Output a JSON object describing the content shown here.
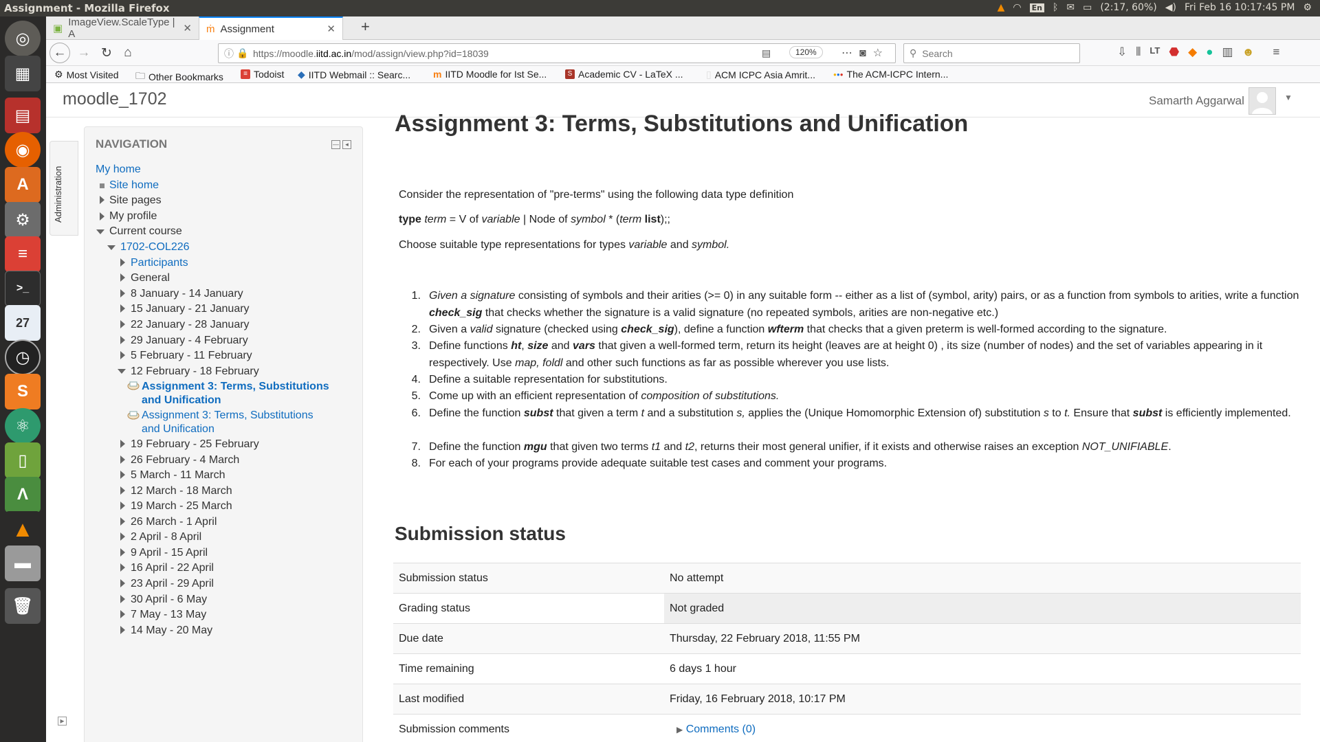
{
  "os": {
    "window_title": "Assignment - Mozilla Firefox",
    "keyboard": "En",
    "battery": "(2:17, 60%)",
    "clock": "Fri Feb 16 10:17:45 PM"
  },
  "browser": {
    "tabs": [
      {
        "label": "ImageView.ScaleType | A"
      },
      {
        "label": "Assignment"
      }
    ],
    "url_prefix": "https://moodle.",
    "url_domain": "iitd.ac.in",
    "url_suffix": "/mod/assign/view.php?id=18039",
    "zoom": "120%",
    "search_placeholder": "Search",
    "bookmarks": [
      {
        "label": "Most Visited"
      },
      {
        "label": "Other Bookmarks"
      },
      {
        "label": "Todoist"
      },
      {
        "label": "IITD Webmail :: Searc..."
      },
      {
        "label": "IITD Moodle for Ist Se..."
      },
      {
        "label": "Academic CV - LaTeX ..."
      },
      {
        "label": "ACM ICPC Asia Amrit..."
      },
      {
        "label": "The ACM-ICPC Intern..."
      }
    ]
  },
  "launcher": {
    "calendar_day": "27"
  },
  "site": {
    "name": "moodle_1702",
    "user": "Samarth Aggarwal"
  },
  "admin_tab": "Administration",
  "navigation": {
    "title": "NAVIGATION",
    "my_home": "My home",
    "site_home": "Site home",
    "site_pages": "Site pages",
    "my_profile": "My profile",
    "current_course": "Current course",
    "course": "1702-COL226",
    "participants": "Participants",
    "general": "General",
    "weeks_before": [
      "8 January - 14 January",
      "15 January - 21 January",
      "22 January - 28 January",
      "29 January - 4 February",
      "5 February - 11 February"
    ],
    "current_week": "12 February - 18 February",
    "active_assignment_line1": "Assignment 3: Terms, Substitutions",
    "active_assignment_line2": "and Unification",
    "other_assignment_line1": "Assignment 3: Terms, Substitutions",
    "other_assignment_line2": "and Unification",
    "weeks_after": [
      "19 February - 25 February",
      "26 February - 4 March",
      "5 March - 11 March",
      "12 March - 18 March",
      "19 March - 25 March",
      "26 March - 1 April",
      "2 April - 8 April",
      "9 April - 15 April",
      "16 April - 22 April",
      "23 April - 29 April",
      "30 April - 6 May",
      "7 May - 13 May",
      "14 May - 20 May"
    ]
  },
  "assignment": {
    "title": "Assignment 3: Terms, Substitutions and Unification",
    "intro1": "Consider the representation of \"pre-terms\" using the following data type definition",
    "type_kw": "type",
    "type_term": "term",
    "type_eq": " = V of ",
    "type_variable": "variable",
    "type_node": " | Node of ",
    "type_symbol": "symbol",
    "type_star": " * (",
    "type_term2": "term",
    "type_list": "list",
    "type_end": ");;",
    "intro3a": "Choose suitable type representations for types ",
    "intro3_variable": "variable",
    "intro3_and": " and ",
    "intro3_symbol": "symbol.",
    "tasks": [
      {
        "n": "1.",
        "a": "Given a signature",
        "b": " consisting of symbols and their arities (>= 0) in any suitable form -- either as a list of (symbol, arity) pairs, or as a function from symbols to arities, write a function ",
        "c": "check_sig",
        "d": " that checks whether the signature is a valid signature (no repeated symbols, arities are non-negative etc.)"
      },
      {
        "n": "2.",
        "a": "Given a ",
        "b": "valid",
        "c": " signature (checked using ",
        "d": "check_sig",
        "e": "), define a function ",
        "f": "wfterm",
        "g": " that checks that a given preterm is well-formed according to the signature."
      },
      {
        "n": "3.",
        "a": "Define functions ",
        "b": "ht",
        "c": ", ",
        "d": "size",
        "e": " and ",
        "f": "vars",
        "g": " that given a well-formed term, return its height (leaves are at height 0) , its size (number of nodes) and the set of variables appearing in it respectively.  Use ",
        "h": "map, foldl",
        "i": " and other such functions as far as possible wherever you use lists."
      },
      {
        "n": "4.",
        "a": "Define a suitable representation for substitutions."
      },
      {
        "n": "5.",
        "a": "Come up with an efficient representation of ",
        "b": "composition of substitutions."
      },
      {
        "n": "6.",
        "a": "Define the function ",
        "b": "subst",
        "c": " that given a term ",
        "d": "t",
        "e": " and a substitution ",
        "f": "s,",
        "g": " applies the (Unique Homomorphic Extension of) substitution ",
        "h": "s",
        "i": " to ",
        "j": "t.",
        "k": "  Ensure that ",
        "l": "subst",
        "m": " is efficiently implemented."
      },
      {
        "n": "7.",
        "a": "Define the function ",
        "b": "mgu",
        "c": " that given two terms ",
        "d": "t1",
        "e": " and ",
        "f": "t2",
        "g": ", returns their most general unifier, if it exists and otherwise raises an exception ",
        "h": "NOT_UNIFIABLE",
        "i": "."
      },
      {
        "n": "8.",
        "a": "For each of your programs provide adequate suitable test cases and comment your programs."
      }
    ]
  },
  "submission": {
    "heading": "Submission status",
    "rows": [
      {
        "label": "Submission status",
        "value": "No attempt"
      },
      {
        "label": "Grading status",
        "value": "Not graded"
      },
      {
        "label": "Due date",
        "value": "Thursday, 22 February 2018, 11:55 PM"
      },
      {
        "label": "Time remaining",
        "value": "6 days 1 hour"
      },
      {
        "label": "Last modified",
        "value": "Friday, 16 February 2018, 10:17 PM"
      },
      {
        "label": "Submission comments",
        "value": "Comments (0)"
      }
    ]
  }
}
